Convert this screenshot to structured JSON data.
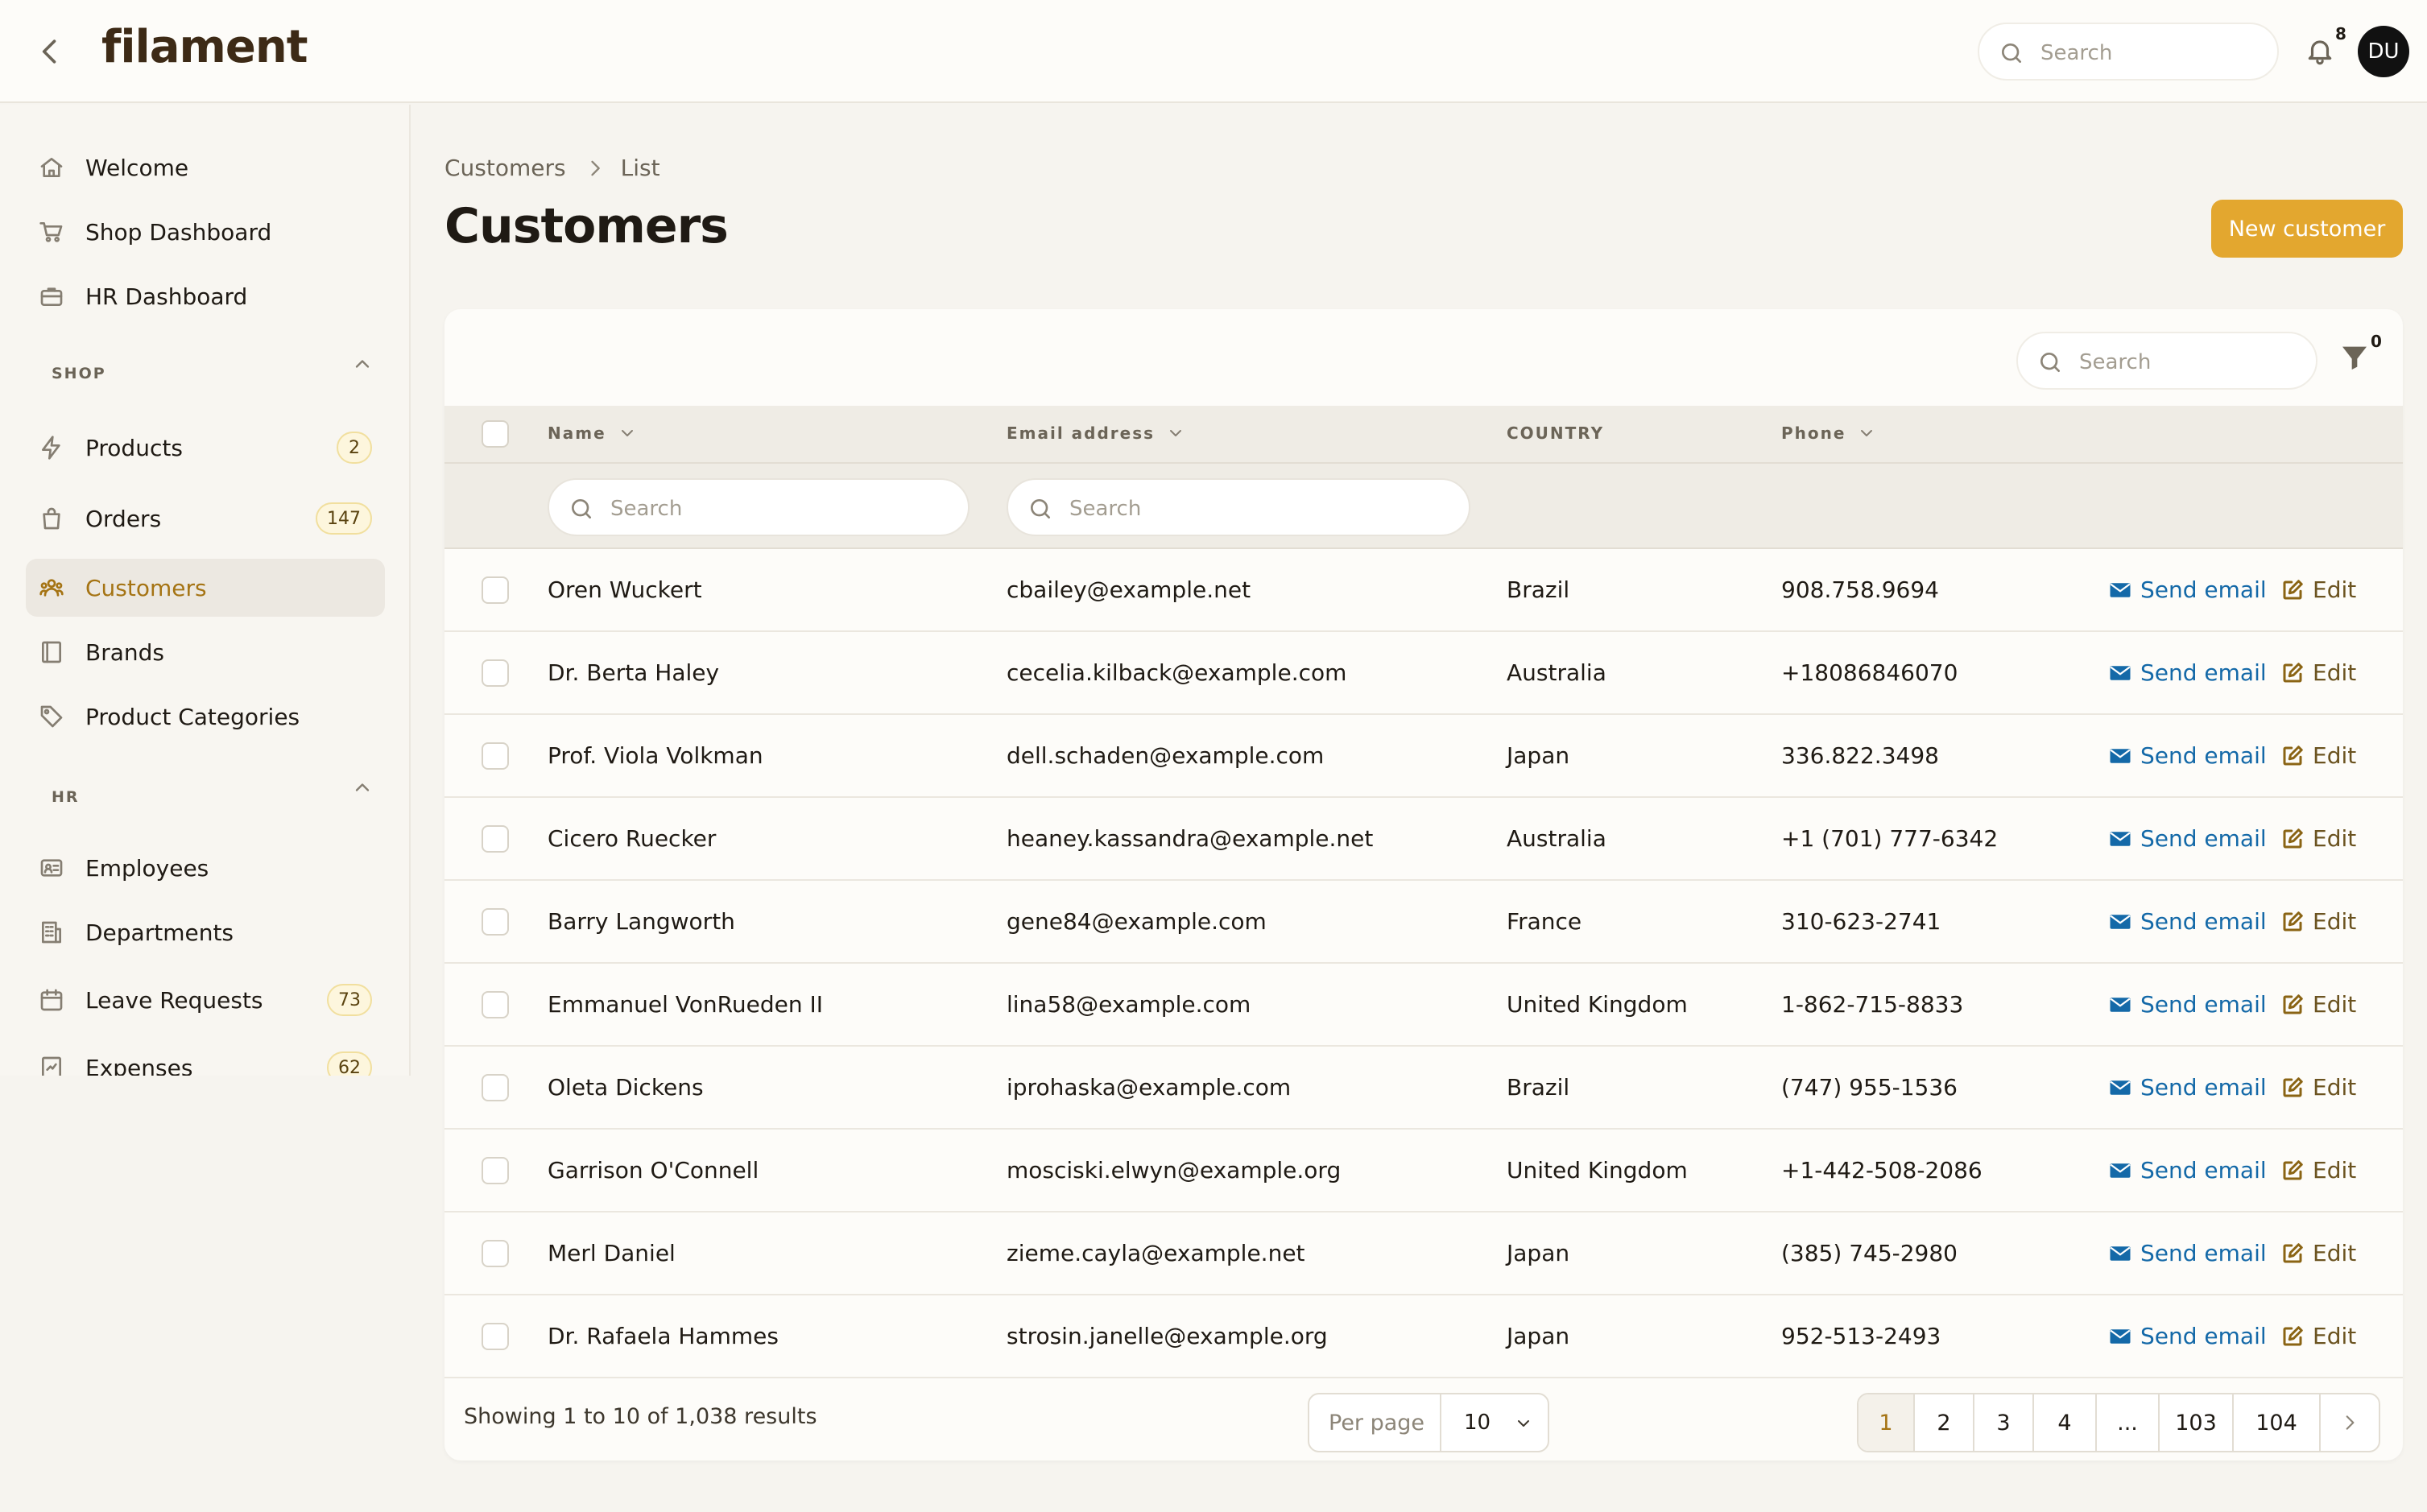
{
  "topbar": {
    "logo": "filament",
    "search_placeholder": "Search",
    "notification_count": "8",
    "avatar_initials": "DU"
  },
  "sidebar": {
    "items_top": [
      {
        "label": "Welcome",
        "icon": "home-icon"
      },
      {
        "label": "Shop Dashboard",
        "icon": "cart-icon"
      },
      {
        "label": "HR Dashboard",
        "icon": "briefcase-icon"
      }
    ],
    "shop_group_label": "SHOP",
    "shop_items": [
      {
        "label": "Products",
        "icon": "bolt-icon",
        "badge": "2"
      },
      {
        "label": "Orders",
        "icon": "shopping-bag-icon",
        "badge": "147"
      },
      {
        "label": "Customers",
        "icon": "users-icon",
        "active": true
      },
      {
        "label": "Brands",
        "icon": "book-icon"
      },
      {
        "label": "Product Categories",
        "icon": "tag-icon"
      }
    ],
    "hr_group_label": "HR",
    "hr_items": [
      {
        "label": "Employees",
        "icon": "id-card-icon"
      },
      {
        "label": "Departments",
        "icon": "building-icon"
      },
      {
        "label": "Leave Requests",
        "icon": "calendar-icon",
        "badge": "73"
      },
      {
        "label": "Expenses",
        "icon": "receipt-icon",
        "badge": "62"
      }
    ]
  },
  "main": {
    "breadcrumb": [
      "Customers",
      "List"
    ],
    "title": "Customers",
    "new_button": "New customer",
    "table_search_placeholder": "Search",
    "filter_count": "0",
    "columns": {
      "name": "Name",
      "email": "Email address",
      "country": "COUNTRY",
      "phone": "Phone"
    },
    "column_search_placeholder": "Search",
    "row_actions": {
      "send_email": "Send email",
      "edit": "Edit"
    },
    "rows": [
      {
        "name": "Oren Wuckert",
        "email": "cbailey@example.net",
        "country": "Brazil",
        "phone": "908.758.9694"
      },
      {
        "name": "Dr. Berta Haley",
        "email": "cecelia.kilback@example.com",
        "country": "Australia",
        "phone": "+18086846070"
      },
      {
        "name": "Prof. Viola Volkman",
        "email": "dell.schaden@example.com",
        "country": "Japan",
        "phone": "336.822.3498"
      },
      {
        "name": "Cicero Ruecker",
        "email": "heaney.kassandra@example.net",
        "country": "Australia",
        "phone": "+1 (701) 777-6342"
      },
      {
        "name": "Barry Langworth",
        "email": "gene84@example.com",
        "country": "France",
        "phone": "310-623-2741"
      },
      {
        "name": "Emmanuel VonRueden II",
        "email": "lina58@example.com",
        "country": "United Kingdom",
        "phone": "1-862-715-8833"
      },
      {
        "name": "Oleta Dickens",
        "email": "iprohaska@example.com",
        "country": "Brazil",
        "phone": "(747) 955-1536"
      },
      {
        "name": "Garrison O'Connell",
        "email": "mosciski.elwyn@example.org",
        "country": "United Kingdom",
        "phone": "+1-442-508-2086"
      },
      {
        "name": "Merl Daniel",
        "email": "zieme.cayla@example.net",
        "country": "Japan",
        "phone": "(385) 745-2980"
      },
      {
        "name": "Dr. Rafaela Hammes",
        "email": "strosin.janelle@example.org",
        "country": "Japan",
        "phone": "952-513-2493"
      }
    ],
    "footer": {
      "results_text": "Showing 1 to 10 of 1,038 results",
      "per_page_label": "Per page",
      "per_page_value": "10",
      "pages": [
        "1",
        "2",
        "3",
        "4",
        "...",
        "103",
        "104"
      ],
      "active_page": "1"
    }
  },
  "colors": {
    "accent": "#e3a72f",
    "active_nav_text": "#a57414",
    "link_blue": "#1469a8",
    "background": "#f6f4ef"
  }
}
